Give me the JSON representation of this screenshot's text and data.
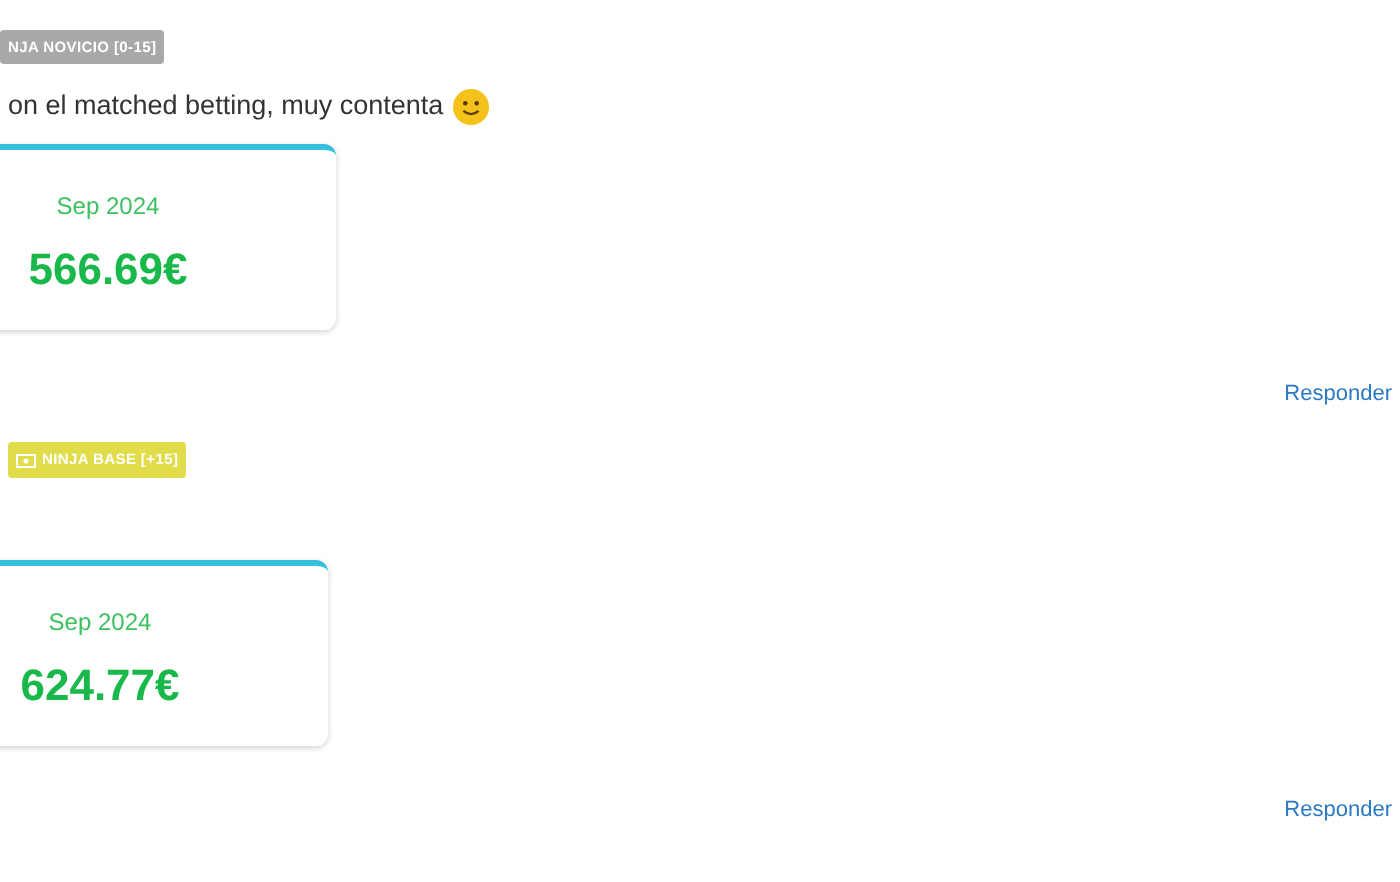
{
  "comments": [
    {
      "badge": {
        "text": "NJA NOVICIO [0-15]",
        "kind": "novice",
        "icon": false
      },
      "text": "on el matched betting, muy contenta",
      "emoji": true,
      "card": {
        "period": "Sep 2024",
        "amount": "566.69€"
      },
      "reply": "Responder"
    },
    {
      "badge": {
        "text": "NINJA BASE [+15]",
        "kind": "base",
        "icon": true
      },
      "emoji": false,
      "card": {
        "period": "Sep 2024",
        "amount": "624.77€"
      },
      "reply": "Responder"
    }
  ]
}
